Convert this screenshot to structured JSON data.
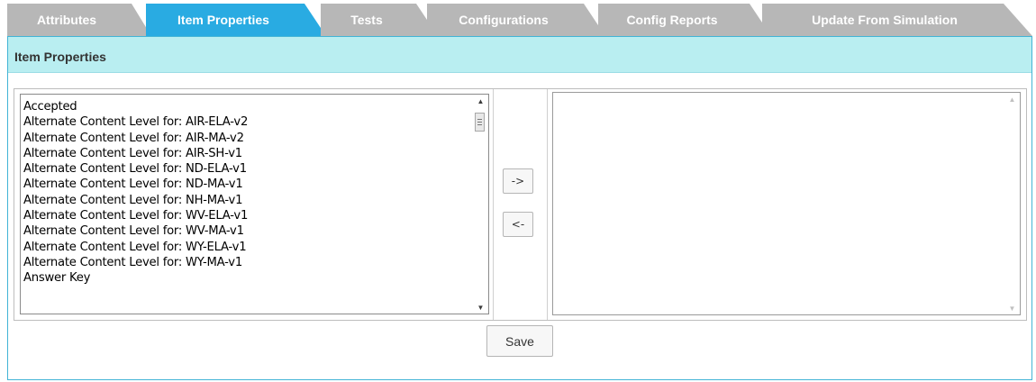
{
  "tabs": [
    {
      "label": "Attributes",
      "active": false
    },
    {
      "label": "Item Properties",
      "active": true
    },
    {
      "label": "Tests",
      "active": false
    },
    {
      "label": "Configurations",
      "active": false
    },
    {
      "label": "Config Reports",
      "active": false
    },
    {
      "label": "Update From Simulation",
      "active": false
    }
  ],
  "section": {
    "title": "Item Properties"
  },
  "available_list": {
    "items": [
      "Accepted",
      "Alternate Content Level for: AIR-ELA-v2",
      "Alternate Content Level for: AIR-MA-v2",
      "Alternate Content Level for: AIR-SH-v1",
      "Alternate Content Level for: ND-ELA-v1",
      "Alternate Content Level for: ND-MA-v1",
      "Alternate Content Level for: NH-MA-v1",
      "Alternate Content Level for: WV-ELA-v1",
      "Alternate Content Level for: WV-MA-v1",
      "Alternate Content Level for: WY-ELA-v1",
      "Alternate Content Level for: WY-MA-v1",
      "Answer Key"
    ]
  },
  "selected_list": {
    "items": []
  },
  "buttons": {
    "add": "->",
    "remove": "<-",
    "save": "Save"
  },
  "colors": {
    "tab_active": "#29abe2",
    "tab_inactive": "#b7b7b7",
    "header_bg": "#b9eef1",
    "border": "#42b4d6"
  }
}
